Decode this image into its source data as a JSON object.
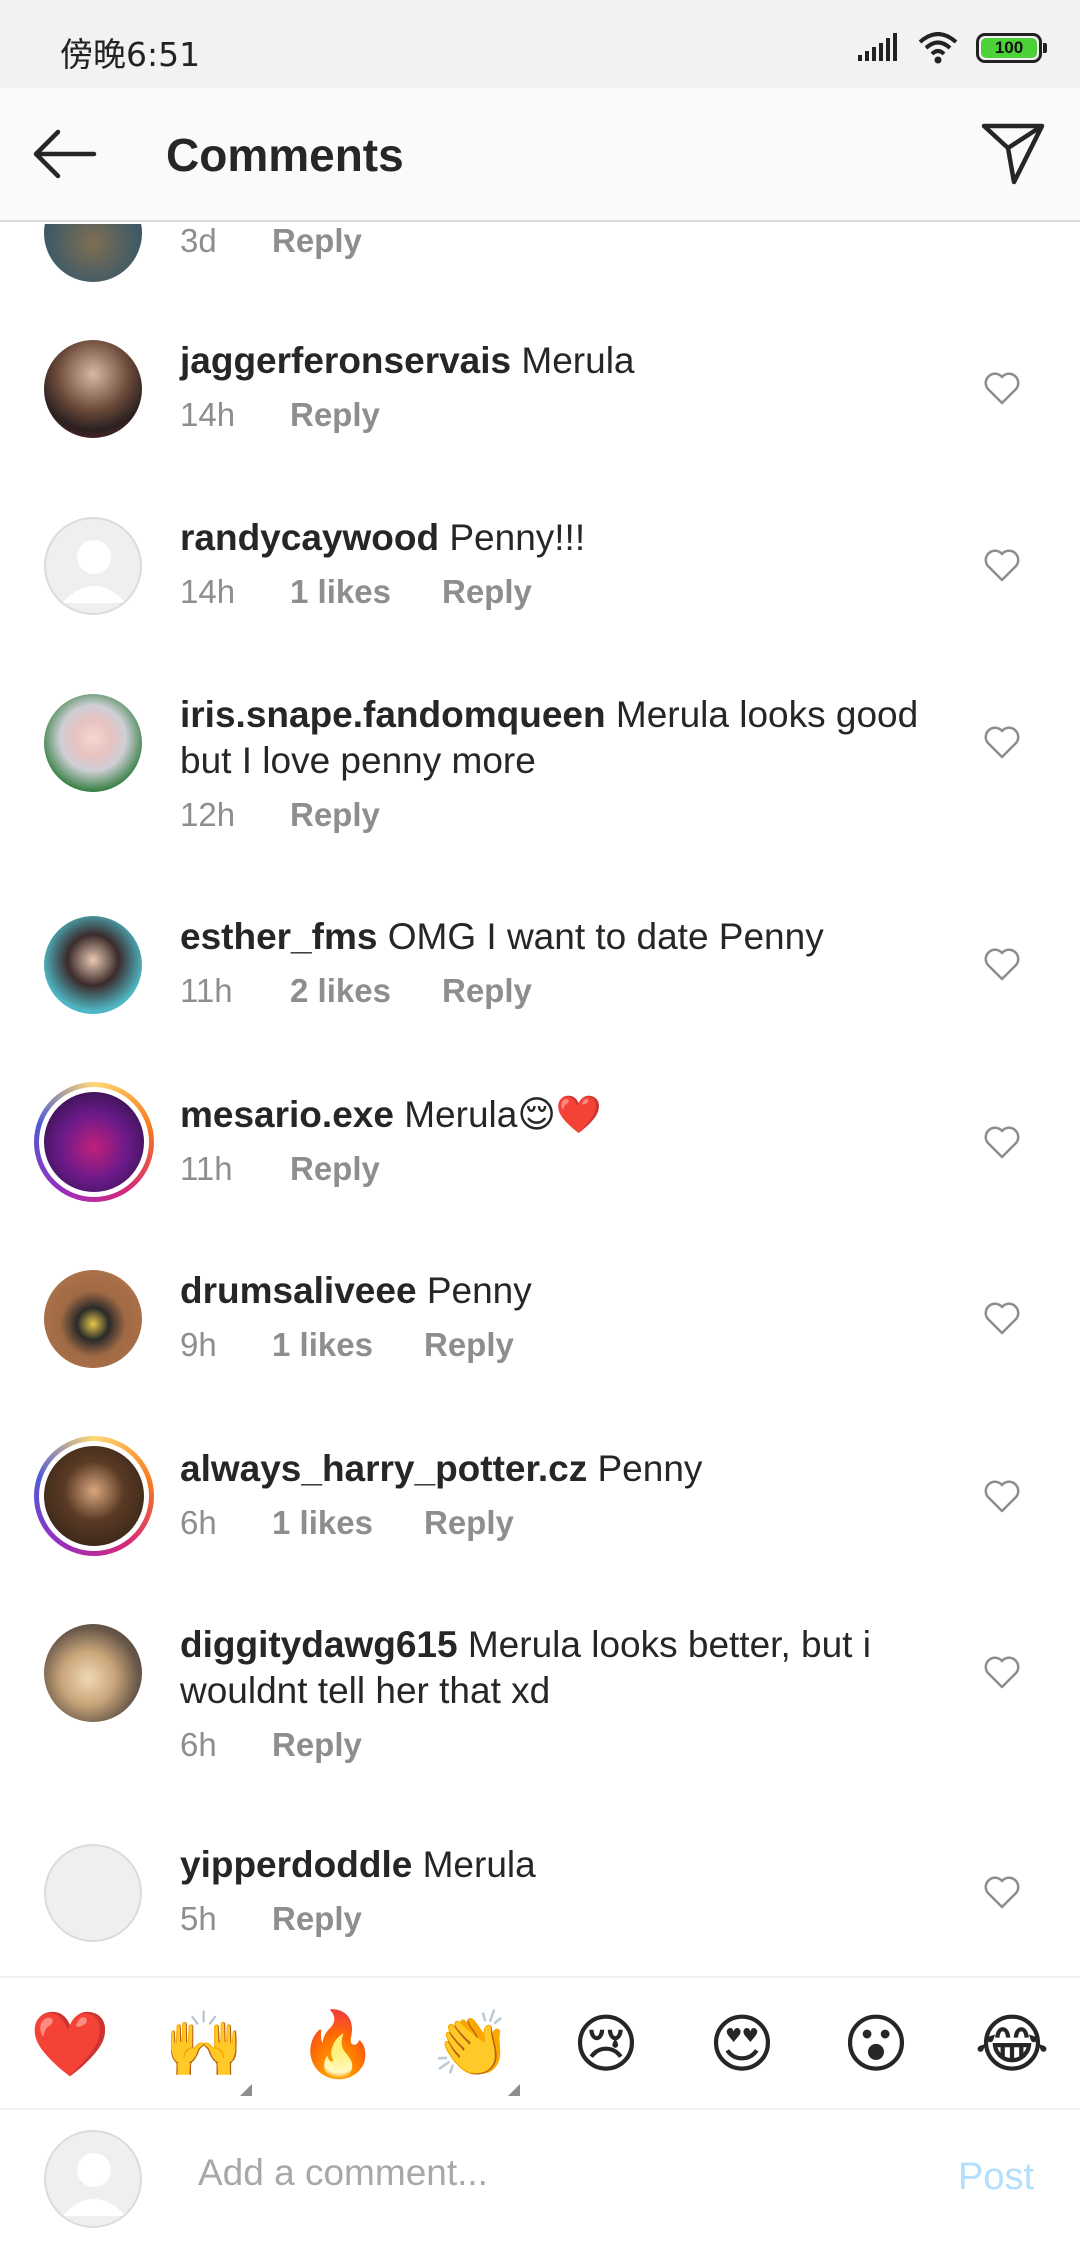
{
  "status_bar": {
    "time": "傍晚6:51",
    "battery": "100"
  },
  "header": {
    "title": "Comments",
    "back_icon": "back-arrow-icon",
    "send_icon": "paper-plane-icon"
  },
  "partial_comment": {
    "time": "3d",
    "reply": "Reply"
  },
  "comments": [
    {
      "username": "jaggerferonservais",
      "text": "Merula",
      "time": "14h",
      "likes": "",
      "reply": "Reply"
    },
    {
      "username": "randycaywood",
      "text": "Penny!!!",
      "time": "14h",
      "likes": "1 likes",
      "reply": "Reply"
    },
    {
      "username": "iris.snape.fandomqueen",
      "text": "Merula looks good but I love penny more",
      "time": "12h",
      "likes": "",
      "reply": "Reply"
    },
    {
      "username": "esther_fms",
      "text": "OMG I want to date Penny",
      "time": "11h",
      "likes": "2 likes",
      "reply": "Reply"
    },
    {
      "username": "mesario.exe",
      "text": "Merula😌❤️",
      "time": "11h",
      "likes": "",
      "reply": "Reply"
    },
    {
      "username": "drumsaliveee",
      "text": "Penny",
      "time": "9h",
      "likes": "1 likes",
      "reply": "Reply"
    },
    {
      "username": "always_harry_potter.cz",
      "text": "Penny",
      "time": "6h",
      "likes": "1 likes",
      "reply": "Reply"
    },
    {
      "username": "diggitydawg615",
      "text": "Merula looks better, but i wouldnt tell her that xd",
      "time": "6h",
      "likes": "",
      "reply": "Reply"
    },
    {
      "username": "yipperdoddle",
      "text": "Merula",
      "time": "5h",
      "likes": "",
      "reply": "Reply"
    }
  ],
  "emoji_bar": [
    "❤️",
    "🙌",
    "🔥",
    "👏",
    "😢",
    "😍",
    "😮",
    "😂"
  ],
  "comment_bar": {
    "placeholder": "Add a comment...",
    "post": "Post"
  },
  "colors": {
    "accent_post": "#b2dffc",
    "text": "#262626",
    "meta": "#8e8e8e"
  }
}
